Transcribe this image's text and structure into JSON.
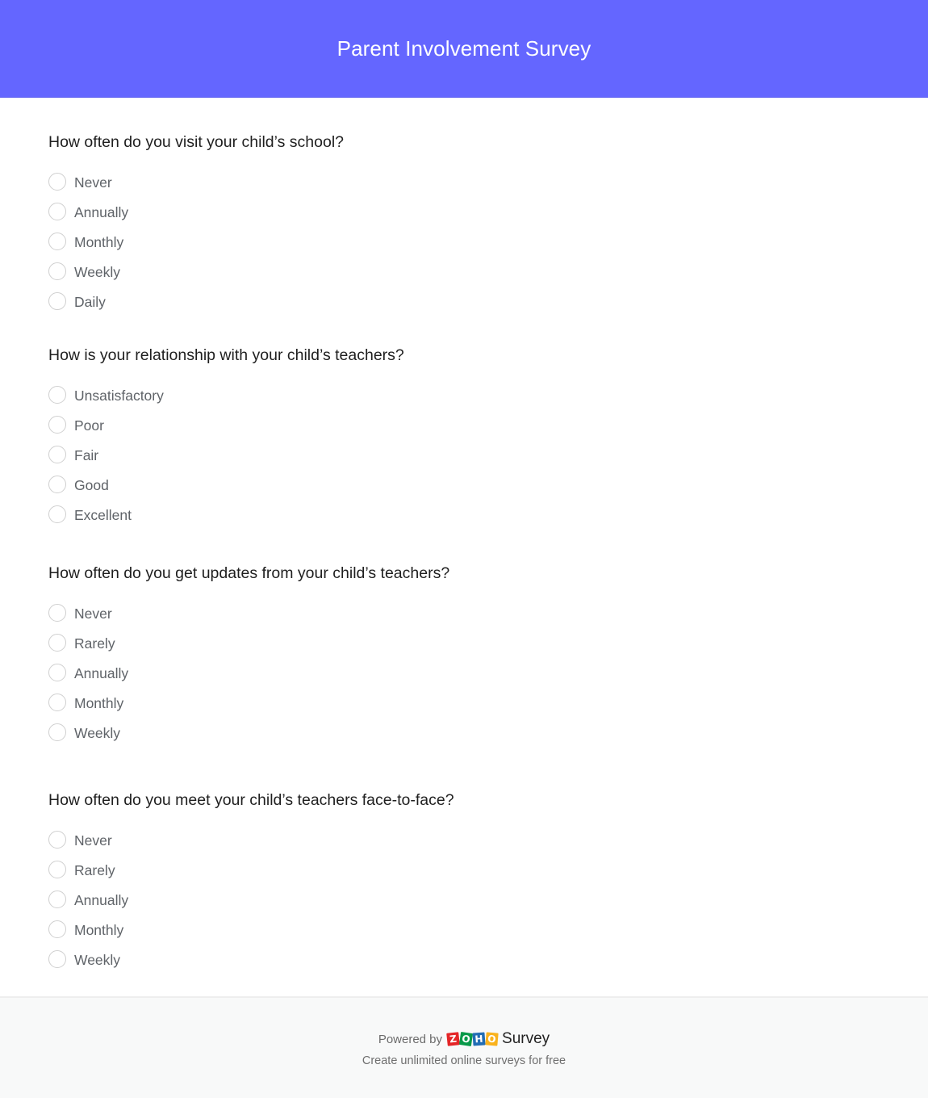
{
  "header": {
    "title": "Parent Involvement Survey",
    "background_color": "#6466FF"
  },
  "questions": [
    {
      "title": "How often do you visit your child’s school?",
      "options": [
        {
          "label": "Never",
          "selected": false
        },
        {
          "label": "Annually",
          "selected": false
        },
        {
          "label": "Monthly",
          "selected": false
        },
        {
          "label": "Weekly",
          "selected": false
        },
        {
          "label": "Daily",
          "selected": false
        }
      ]
    },
    {
      "title": "How is your relationship with your child’s teachers?",
      "options": [
        {
          "label": "Unsatisfactory",
          "selected": false
        },
        {
          "label": "Poor",
          "selected": false
        },
        {
          "label": "Fair",
          "selected": false
        },
        {
          "label": "Good",
          "selected": false
        },
        {
          "label": "Excellent",
          "selected": false
        }
      ]
    },
    {
      "title": "How often do you get updates from your child’s teachers?",
      "options": [
        {
          "label": "Never",
          "selected": false
        },
        {
          "label": "Rarely",
          "selected": false
        },
        {
          "label": "Annually",
          "selected": false
        },
        {
          "label": "Monthly",
          "selected": false
        },
        {
          "label": "Weekly",
          "selected": false
        }
      ]
    },
    {
      "title": "How often do you meet your child’s teachers face-to-face?",
      "options": [
        {
          "label": "Never",
          "selected": false
        },
        {
          "label": "Rarely",
          "selected": false
        },
        {
          "label": "Annually",
          "selected": false
        },
        {
          "label": "Monthly",
          "selected": false
        },
        {
          "label": "Weekly",
          "selected": false
        }
      ]
    }
  ],
  "footer": {
    "powered_by": "Powered by",
    "logo": {
      "icon": "zoho-logo-icon",
      "tiles": [
        {
          "letter": "Z",
          "color": "#E42527"
        },
        {
          "letter": "O",
          "color": "#089949"
        },
        {
          "letter": "H",
          "color": "#226DB4"
        },
        {
          "letter": "O",
          "color": "#F9B21D"
        }
      ]
    },
    "brand_product": "Survey",
    "tagline": "Create unlimited online surveys for free"
  }
}
